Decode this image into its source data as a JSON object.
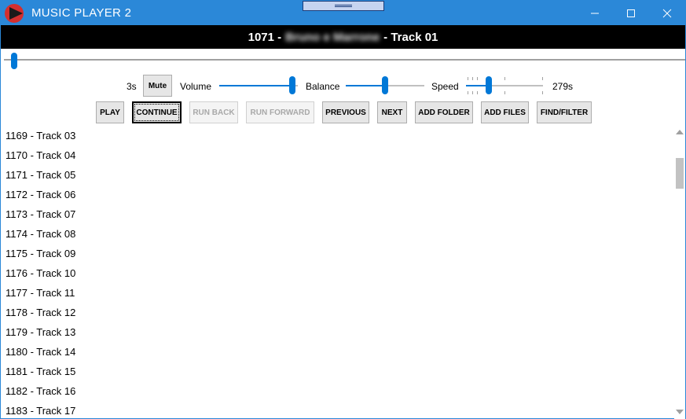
{
  "window": {
    "title": "MUSIC PLAYER 2",
    "accent_color": "#2b88d8",
    "icons": {
      "app": "play-triangle-icon",
      "minimize": "minimize-icon",
      "maximize": "maximize-icon",
      "close": "close-icon"
    }
  },
  "now_playing": {
    "number": "1071 -",
    "artist": "Bruno e Marrone",
    "track": "- Track 01"
  },
  "seek": {
    "position_fraction": 0.005
  },
  "controls": {
    "elapsed": "3s",
    "mute_label": "Mute",
    "volume_label": "Volume",
    "volume_fraction": 0.97,
    "balance_label": "Balance",
    "balance_fraction": 0.5,
    "speed_label": "Speed",
    "speed_fraction": 0.28,
    "total": "279s"
  },
  "buttons": [
    {
      "label": "PLAY",
      "enabled": true
    },
    {
      "label": "CONTINUE",
      "enabled": true,
      "focused": true
    },
    {
      "label": "RUN BACK",
      "enabled": false
    },
    {
      "label": "RUN FORWARD",
      "enabled": false
    },
    {
      "label": "PREVIOUS",
      "enabled": true
    },
    {
      "label": "NEXT",
      "enabled": true
    },
    {
      "label": "ADD FOLDER",
      "enabled": true
    },
    {
      "label": "ADD FILES",
      "enabled": true
    },
    {
      "label": "FIND/FILTER",
      "enabled": true
    }
  ],
  "playlist": [
    "1169 - Track 03",
    "1170 - Track 04",
    "1171 - Track 05",
    "1172 - Track 06",
    "1173 - Track 07",
    "1174 - Track 08",
    "1175 - Track 09",
    "1176 - Track 10",
    "1177 - Track 11",
    "1178 - Track 12",
    "1179 - Track 13",
    "1180 - Track 14",
    "1181 - Track 15",
    "1182 - Track 16",
    "1183 - Track 17"
  ]
}
